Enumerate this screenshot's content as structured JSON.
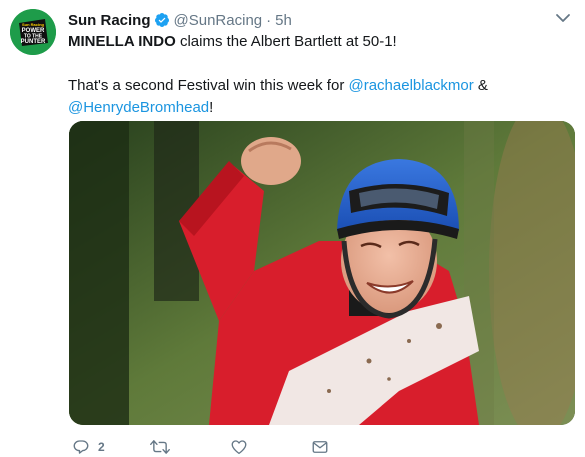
{
  "tweet": {
    "author_name": "Sun Racing",
    "handle": "@SunRacing",
    "separator": "·",
    "time": "5h",
    "verified": true,
    "avatar": {
      "icon": "sun-racing-logo-icon",
      "line1": "Sun Racing",
      "line2": "POWER",
      "line3": "TO THE",
      "line4": "PUNTER",
      "color": "#1e9c4a"
    },
    "text": {
      "line1_bold": "MINELLA INDO",
      "line1_rest": " claims the Albert Bartlett at 50-1!",
      "line2_start": "That's a second Festival win this week for ",
      "mention1": "@rachaelblackmor",
      "line2_mid": " &",
      "mention2": "@HenrydeBromhead",
      "line2_end": "!"
    },
    "media": {
      "description_icon": "jockey-celebration-photo"
    },
    "actions": {
      "reply_count": "2",
      "retweet_count": "",
      "like_count": ""
    },
    "colors": {
      "link": "#1b95e0",
      "secondary": "#657786",
      "verified": "#1da1f2"
    }
  }
}
